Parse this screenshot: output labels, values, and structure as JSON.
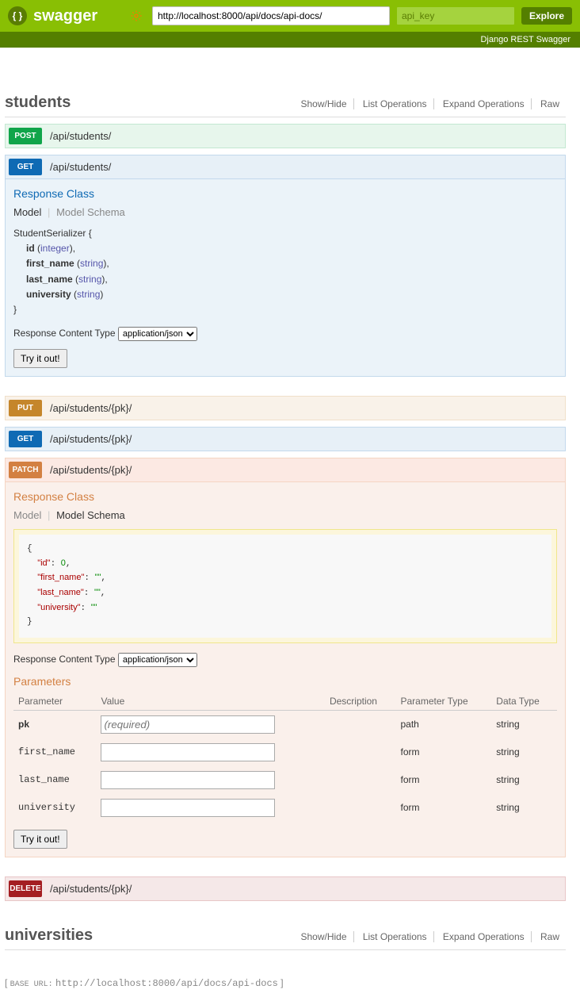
{
  "header": {
    "logo": "swagger",
    "url": "http://localhost:8000/api/docs/api-docs/",
    "apikey_placeholder": "api_key",
    "explore": "Explore"
  },
  "subheader": "Django REST Swagger",
  "resource_ops": {
    "showhide": "Show/Hide",
    "list": "List Operations",
    "expand": "Expand Operations",
    "raw": "Raw"
  },
  "resources": [
    {
      "name": "students"
    },
    {
      "name": "universities"
    }
  ],
  "endpoints": {
    "post": {
      "path": "/api/students/"
    },
    "get": {
      "path": "/api/students/"
    },
    "put": {
      "path": "/api/students/{pk}/"
    },
    "get_pk": {
      "path": "/api/students/{pk}/"
    },
    "patch": {
      "path": "/api/students/{pk}/"
    },
    "delete": {
      "path": "/api/students/{pk}/"
    }
  },
  "labels": {
    "response_class": "Response Class",
    "model": "Model",
    "model_schema": "Model Schema",
    "response_content_type": "Response Content Type",
    "content_type": "application/json",
    "try": "Try it out!",
    "parameters": "Parameters",
    "param_h": {
      "param": "Parameter",
      "value": "Value",
      "desc": "Description",
      "ptype": "Parameter Type",
      "dtype": "Data Type"
    }
  },
  "model": {
    "name": "StudentSerializer {",
    "fields": [
      {
        "name": "id",
        "type": "integer"
      },
      {
        "name": "first_name",
        "type": "string"
      },
      {
        "name": "last_name",
        "type": "string"
      },
      {
        "name": "university",
        "type": "string"
      }
    ],
    "close": "}"
  },
  "chart_data": {
    "type": "table",
    "title": "PATCH /api/students/{pk}/ — Parameters",
    "columns": [
      "Parameter",
      "Value",
      "Description",
      "Parameter Type",
      "Data Type"
    ],
    "rows": [
      {
        "param": "pk",
        "value": "(required)",
        "desc": "",
        "ptype": "path",
        "dtype": "string"
      },
      {
        "param": "first_name",
        "value": "",
        "desc": "",
        "ptype": "form",
        "dtype": "string"
      },
      {
        "param": "last_name",
        "value": "",
        "desc": "",
        "ptype": "form",
        "dtype": "string"
      },
      {
        "param": "university",
        "value": "",
        "desc": "",
        "ptype": "form",
        "dtype": "string"
      }
    ]
  },
  "schema_json": {
    "id": 0,
    "first_name": "",
    "last_name": "",
    "university": ""
  },
  "footer": {
    "label": "BASE URL:",
    "url": "http://localhost:8000/api/docs/api-docs"
  }
}
